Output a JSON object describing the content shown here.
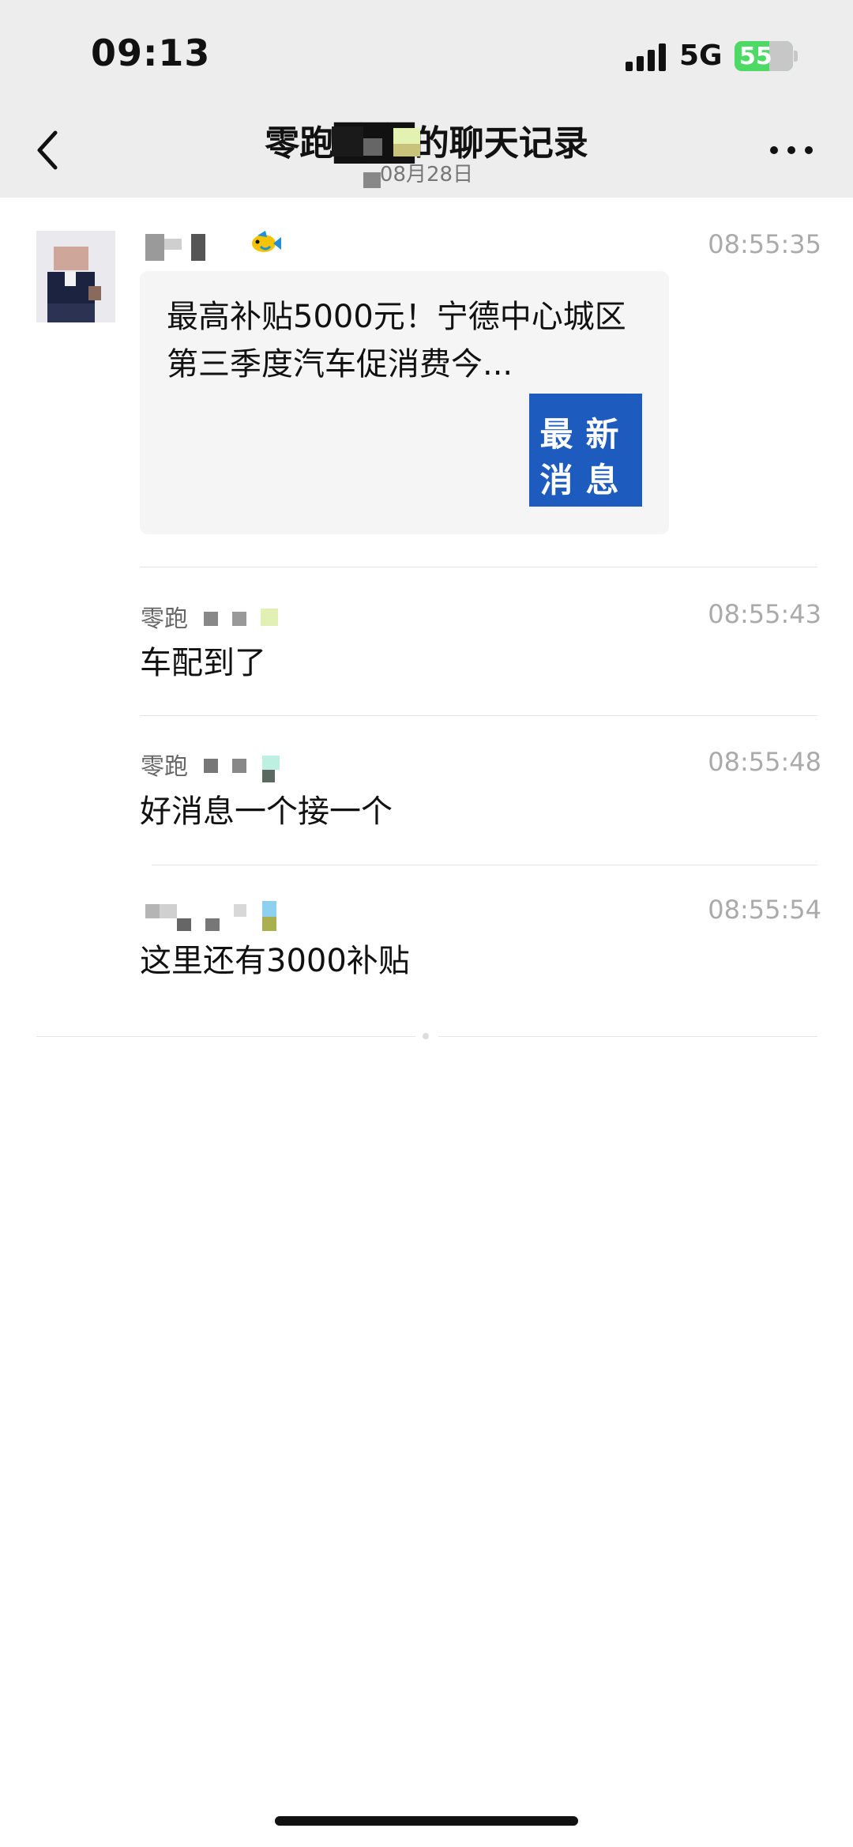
{
  "status_bar": {
    "time": "09:13",
    "network": "5G",
    "battery": "55",
    "signal_icon": "signal-bars-icon",
    "battery_icon": "battery-charging-icon"
  },
  "nav": {
    "title": "零跑███的聊天记录",
    "subtitle": "08月28日",
    "back_icon": "chevron-left-icon",
    "more_icon": "more-dots-icon"
  },
  "messages": [
    {
      "time": "08:55:35",
      "type": "link-card",
      "card": {
        "title": "最高补贴5000元！宁德中心城区第三季度汽车促消费今...",
        "thumbnail_line1": "最新",
        "thumbnail_line2": "消息",
        "thumbnail_color": "#1d5bbf"
      }
    },
    {
      "sender_prefix": "零跑",
      "time": "08:55:43",
      "text": "车配到了"
    },
    {
      "sender_prefix": "零跑",
      "time": "08:55:48",
      "text": "好消息一个接一个"
    },
    {
      "time": "08:55:54",
      "text": "这里还有3000补贴"
    }
  ],
  "colors": {
    "header_bg": "#ededed",
    "timestamp": "#aaaaaa",
    "battery_green": "#4cd964"
  }
}
